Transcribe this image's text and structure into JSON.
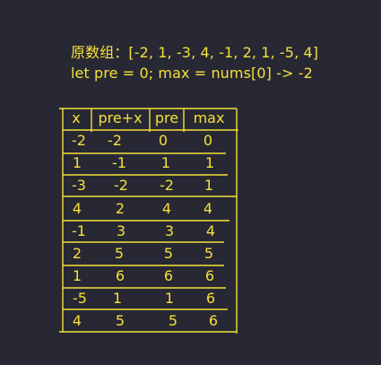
{
  "intro": {
    "line1": "原数组：[-2, 1, -3, 4, -1, 2, 1, -5, 4]",
    "line2": "let pre = 0; max = nums[0] -> -2"
  },
  "table": {
    "headers": [
      "x",
      "pre+x",
      "pre",
      "max"
    ],
    "rows": [
      [
        "-2",
        "-2",
        "0",
        "0"
      ],
      [
        "1",
        "-1",
        "1",
        "1"
      ],
      [
        "-3",
        "-2",
        "-2",
        "1"
      ],
      [
        "4",
        "2",
        "4",
        "4"
      ],
      [
        "-1",
        "3",
        "3",
        "4"
      ],
      [
        "2",
        "5",
        "5",
        "5"
      ],
      [
        "1",
        "6",
        "6",
        "6"
      ],
      [
        "-5",
        "1",
        "1",
        "6"
      ],
      [
        "4",
        "5",
        "5",
        "6"
      ]
    ]
  },
  "colors": {
    "background": "#272833",
    "text": "#f5e03a"
  }
}
